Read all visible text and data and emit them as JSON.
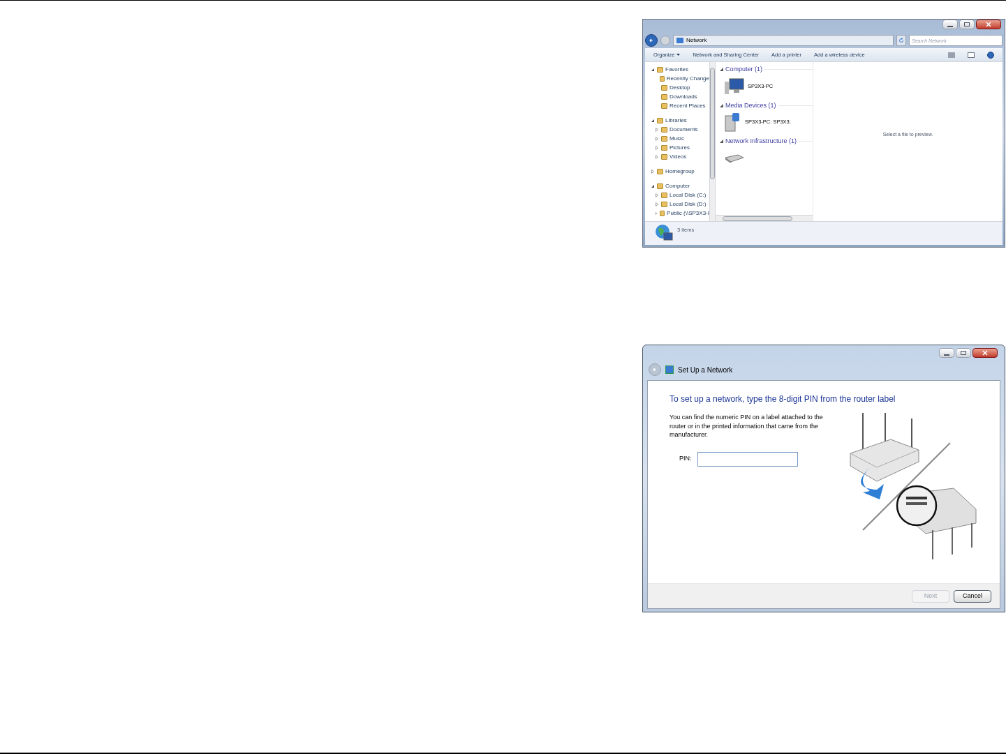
{
  "explorer": {
    "breadcrumb": "Network",
    "search": {
      "placeholder": "Search Network"
    },
    "toolbar": [
      {
        "label": "Organize",
        "dropdown": true
      },
      {
        "label": "Network and Sharing Center",
        "dropdown": false
      },
      {
        "label": "Add a printer",
        "dropdown": false
      },
      {
        "label": "Add a wireless device",
        "dropdown": false
      }
    ],
    "nav_tree": [
      {
        "label": "Favorites",
        "expanded": true,
        "children": [
          {
            "label": "Recently Change"
          },
          {
            "label": "Desktop"
          },
          {
            "label": "Downloads"
          },
          {
            "label": "Recent Places"
          }
        ]
      },
      {
        "label": "Libraries",
        "expanded": true,
        "children": [
          {
            "label": "Documents",
            "expanded": false
          },
          {
            "label": "Music",
            "expanded": false
          },
          {
            "label": "Pictures",
            "expanded": false
          },
          {
            "label": "Videos",
            "expanded": false
          }
        ]
      },
      {
        "label": "Homegroup",
        "expanded": false
      },
      {
        "label": "Computer",
        "expanded": true,
        "children": [
          {
            "label": "Local Disk (C:)",
            "expanded": false
          },
          {
            "label": "Local Disk (D:)",
            "expanded": false
          },
          {
            "label": "Public (\\\\SP3X3-I",
            "expanded": false
          }
        ]
      }
    ],
    "groups": [
      {
        "title": "Computer (1)",
        "kind": "computer",
        "item": "SP3X3-PC"
      },
      {
        "title": "Media Devices (1)",
        "kind": "media",
        "item": "SP3X3-PC: SP3X3:"
      },
      {
        "title": "Network Infrastructure (1)",
        "kind": "router"
      }
    ],
    "preview": "Select a file to preview.",
    "status": "3 items"
  },
  "dialog": {
    "title": "Set Up a Network",
    "heading": "To set up a network, type the 8-digit PIN from the router label",
    "body": "You can find the numeric PIN on a label attached to the router or in the printed information that came from the manufacturer.",
    "pin_label": "PIN:",
    "buttons": [
      {
        "label": "Next",
        "disabled": true
      },
      {
        "label": "Cancel",
        "disabled": false
      }
    ]
  }
}
